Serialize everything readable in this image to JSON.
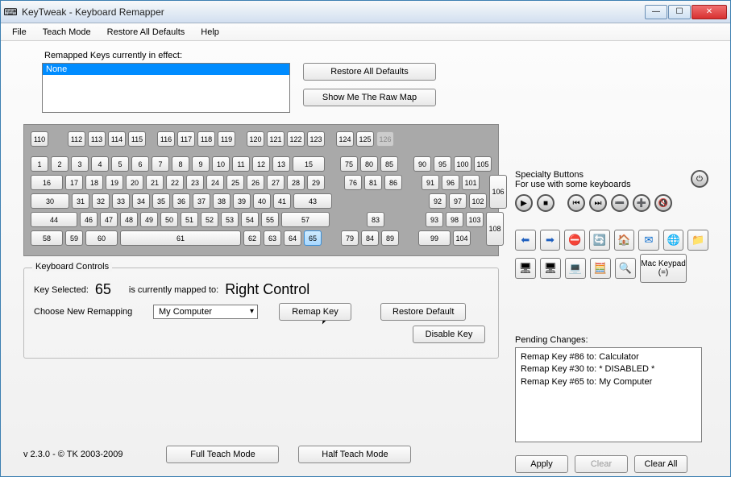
{
  "titlebar": {
    "title": "KeyTweak -   Keyboard Remapper"
  },
  "menubar": {
    "file": "File",
    "teach": "Teach Mode",
    "restore": "Restore All Defaults",
    "help": "Help"
  },
  "remapped": {
    "label": "Remapped Keys currently in effect:",
    "selected": "None"
  },
  "buttons": {
    "restore_all": "Restore All Defaults",
    "show_raw": "Show Me The Raw Map",
    "remap": "Remap Key",
    "restore_default": "Restore Default",
    "disable": "Disable Key",
    "full_teach": "Full Teach Mode",
    "half_teach": "Half Teach Mode",
    "apply": "Apply",
    "clear": "Clear",
    "clear_all": "Clear All",
    "mac": "Mac Keypad (=)"
  },
  "keyboard_controls": {
    "legend": "Keyboard Controls",
    "key_selected_label": "Key Selected:",
    "key_selected_value": "65",
    "mapped_label": "is currently mapped to:",
    "mapped_value": "Right Control",
    "choose_label": "Choose New Remapping",
    "choose_value": "My Computer"
  },
  "specialty": {
    "label": "Specialty Buttons",
    "sub": "For use with some keyboards"
  },
  "pending": {
    "label": "Pending Changes:",
    "items": [
      "Remap Key #86 to: Calculator",
      "Remap Key #30 to: * DISABLED *",
      "Remap Key #65 to: My Computer"
    ]
  },
  "footer": {
    "version": "v 2.3.0 - © TK 2003-2009"
  },
  "keys": {
    "func_row": [
      "110",
      "112",
      "113",
      "114",
      "115",
      "116",
      "117",
      "118",
      "119",
      "120",
      "121",
      "122",
      "123",
      "124",
      "125",
      "126"
    ],
    "row1_main": [
      "1",
      "2",
      "3",
      "4",
      "5",
      "6",
      "7",
      "8",
      "9",
      "10",
      "11",
      "12",
      "13",
      "15"
    ],
    "row1_nav": [
      "75",
      "80",
      "85"
    ],
    "row1_num": [
      "90",
      "95",
      "100",
      "105"
    ],
    "row2_main": [
      "16",
      "17",
      "18",
      "19",
      "20",
      "21",
      "22",
      "23",
      "24",
      "25",
      "26",
      "27",
      "28",
      "29"
    ],
    "row2_nav": [
      "76",
      "81",
      "86"
    ],
    "row2_num": [
      "91",
      "96",
      "101"
    ],
    "row3_main": [
      "30",
      "31",
      "32",
      "33",
      "34",
      "35",
      "36",
      "37",
      "38",
      "39",
      "40",
      "41",
      "43"
    ],
    "row3_num": [
      "92",
      "97",
      "102"
    ],
    "row4_main": [
      "44",
      "46",
      "47",
      "48",
      "49",
      "50",
      "51",
      "52",
      "53",
      "54",
      "55",
      "57"
    ],
    "row4_nav": [
      "83"
    ],
    "row4_num": [
      "93",
      "98",
      "103"
    ],
    "row5_main": [
      "58",
      "59",
      "60",
      "61",
      "62",
      "63",
      "64",
      "65"
    ],
    "row5_nav": [
      "79",
      "84",
      "89"
    ],
    "row5_num": [
      "99",
      "104"
    ],
    "num_tall1": "106",
    "num_tall2": "108"
  }
}
